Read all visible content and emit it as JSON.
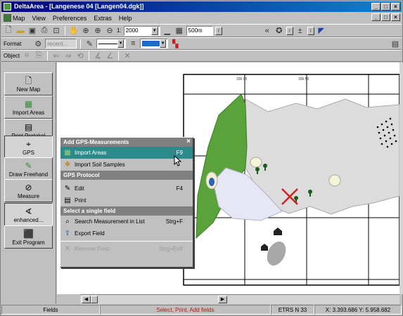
{
  "window": {
    "title": "DeltaArea - [Langenese 04 [Langen04.dgk]]",
    "buttons": [
      "_",
      "□",
      "×"
    ],
    "child_buttons": [
      "_",
      "□",
      "×"
    ]
  },
  "menu": {
    "items": [
      "Map",
      "View",
      "Preferences",
      "Extras",
      "Help"
    ]
  },
  "toolbar1": {
    "scale_label": "1:",
    "scale_value": "2000",
    "grid_value": "500m"
  },
  "toolbar2": {
    "format_label": "Format",
    "recent_placeholder": "recent..."
  },
  "toolbar3": {
    "object_label": "Object"
  },
  "sidebar": {
    "buttons": [
      {
        "label": "New Map",
        "icon": "new-map-icon",
        "glyph": "🗋"
      },
      {
        "label": "Import Areas",
        "icon": "import-areas-icon",
        "glyph": "▦"
      },
      {
        "label": "Print Protokol",
        "icon": "print-icon",
        "glyph": "▤"
      },
      {
        "label": "GPS",
        "icon": "gps-icon",
        "glyph": "⌖"
      },
      {
        "label": "Draw Freehand",
        "icon": "draw-icon",
        "glyph": "✎"
      },
      {
        "label": "Measure",
        "icon": "measure-icon",
        "glyph": "⊘"
      },
      {
        "label": "enhanced...",
        "icon": "enhanced-icon",
        "glyph": "∢"
      },
      {
        "label": "Exit Program",
        "icon": "exit-icon",
        "glyph": "⬛"
      }
    ]
  },
  "popup": {
    "title": "Add GPS-Measurements",
    "close": "×",
    "items": [
      {
        "label": "Import Areas",
        "shortcut": "F9",
        "icon": "import-areas-icon",
        "selected": true,
        "disabled": false
      },
      {
        "label": "Import Soil Samples",
        "shortcut": "",
        "icon": "soil-samples-icon",
        "selected": false,
        "disabled": false
      }
    ],
    "section2_title": "GPS Protocol",
    "section2_items": [
      {
        "label": "Edit",
        "shortcut": "F4",
        "icon": "edit-icon",
        "disabled": false
      },
      {
        "label": "Print",
        "shortcut": "",
        "icon": "print-icon",
        "disabled": false
      }
    ],
    "section3_title": "Select a single field",
    "section3_items": [
      {
        "label": "Search Measurement in List",
        "shortcut": "Strg+F",
        "icon": "search-list-icon",
        "disabled": false
      },
      {
        "label": "Export Field",
        "shortcut": "",
        "icon": "export-icon",
        "disabled": false
      },
      {
        "label": "Remove Field",
        "shortcut": "Strg+Entf",
        "icon": "remove-icon",
        "disabled": true
      }
    ]
  },
  "map": {
    "grid_label_1": "336 00",
    "grid_label_2": "336 50"
  },
  "status": {
    "left": "Fields",
    "middle": "Select, Print, Add fields",
    "crs": "ETRS N 33",
    "coords": "X: 3.393.686  Y: 5.958.682"
  },
  "colors": {
    "title_start": "#000080",
    "selection": "#2e8a8a",
    "field_green": "#5aa33a",
    "field_gray": "#dcdcdc",
    "marker_red": "#d02020"
  }
}
